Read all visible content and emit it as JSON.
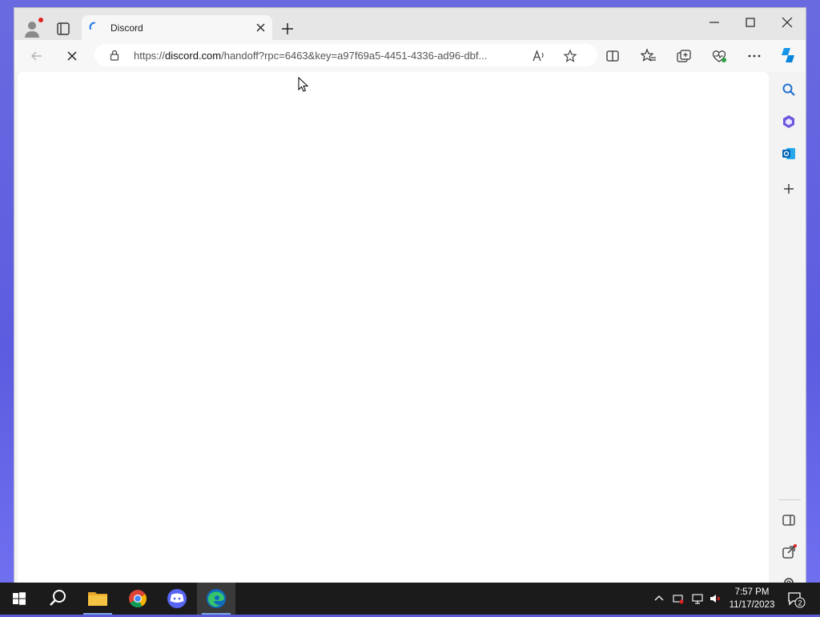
{
  "browser": {
    "tab": {
      "title": "Discord"
    },
    "address": {
      "url_scheme": "https://",
      "url_host": "discord.com",
      "url_rest": "/handoff?rpc=6463&key=a97f69a5-4451-4336-ad96-dbf..."
    }
  },
  "taskbar": {
    "apps": [
      "start-icon",
      "search-icon",
      "file-explorer-icon",
      "chrome-icon",
      "discord-icon",
      "edge-icon"
    ],
    "clock": {
      "time": "7:57 PM",
      "date": "11/17/2023"
    },
    "notification_count": "2"
  },
  "colors": {
    "desktop": "#5b5bd6",
    "taskbar": "#1b1b1b",
    "edge_accent": "#0f6cbd"
  }
}
